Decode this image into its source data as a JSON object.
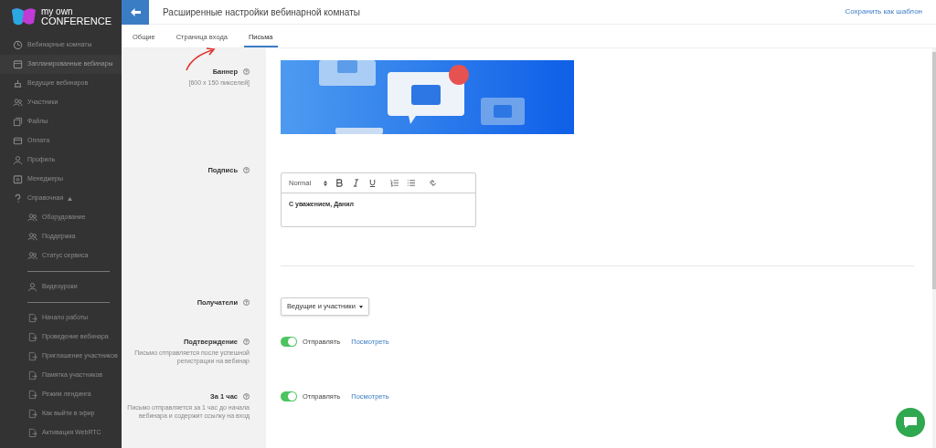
{
  "logo": {
    "line1": "my own",
    "line2": "CONFERENCE"
  },
  "sidebar": {
    "items": [
      {
        "label": "Вебинарные комнаты",
        "selected": false
      },
      {
        "label": "Запланированные вебинары",
        "selected": true
      },
      {
        "label": "Ведущие вебинаров",
        "selected": false
      },
      {
        "label": "Участники",
        "selected": false
      },
      {
        "label": "Файлы",
        "selected": false
      },
      {
        "label": "Оплата",
        "selected": false
      },
      {
        "label": "Профиль",
        "selected": false
      },
      {
        "label": "Менеджеры",
        "selected": false
      },
      {
        "label": "Справочная",
        "selected": false,
        "expanded": true,
        "sections": [
          {
            "items": [
              {
                "label": "Оборудование"
              },
              {
                "label": "Поддержка"
              },
              {
                "label": "Статус сервиса"
              }
            ]
          },
          {
            "items": [
              {
                "label": "Видеоуроки"
              }
            ]
          },
          {
            "items": [
              {
                "label": "Начало работы"
              },
              {
                "label": "Проведение вебинара"
              },
              {
                "label": "Приглашение участников"
              },
              {
                "label": "Памятка участников"
              },
              {
                "label": "Режим лендинга"
              },
              {
                "label": "Как выйти в эфир"
              },
              {
                "label": "Активация WebRTC"
              }
            ]
          }
        ]
      }
    ]
  },
  "header": {
    "title": "Расширенные настройки вебинарной комнаты",
    "action": "Сохранить как шаблон"
  },
  "tabs": [
    {
      "label": "Общие",
      "selected": false
    },
    {
      "label": "Страница входа",
      "selected": false
    },
    {
      "label": "Письма",
      "selected": true
    }
  ],
  "fields": [
    {
      "kind": "banner",
      "label": "Баннер",
      "hint": "[600 x 150 пикселей]"
    },
    {
      "kind": "editor",
      "label": "Подпись",
      "format": "Normal",
      "text": "С уважением, Данил"
    },
    {
      "kind": "select",
      "label": "Получатели",
      "value": "Ведущие и участники"
    },
    {
      "kind": "toggle",
      "label": "Подтверждение",
      "hint": "Письмо отправляется после успешной регистрации на вебинар",
      "on": true,
      "toggle_label": "Отправлять",
      "link": "Посмотреть"
    },
    {
      "kind": "toggle",
      "label": "За 1 час",
      "hint": "Письмо отправляется за 1 час до начала вебинара и содержит ссылку на вход",
      "on": true,
      "toggle_label": "Отправлять",
      "link": "Посмотреть"
    }
  ]
}
